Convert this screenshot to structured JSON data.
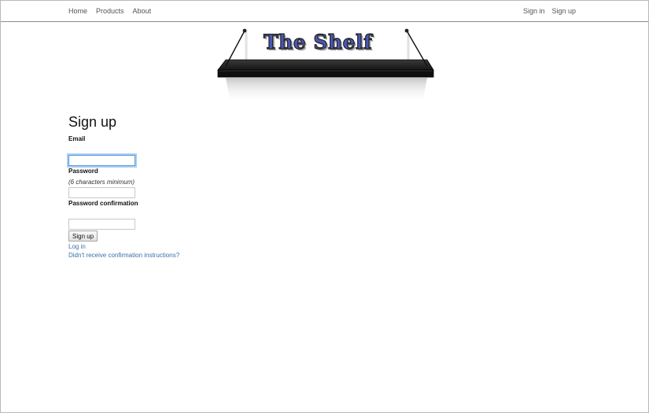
{
  "nav": {
    "left": [
      {
        "label": "Home"
      },
      {
        "label": "Products"
      },
      {
        "label": "About"
      }
    ],
    "right": [
      {
        "label": "Sign in"
      },
      {
        "label": "Sign up"
      }
    ]
  },
  "logo": {
    "text": "The Shelf"
  },
  "form": {
    "title": "Sign up",
    "email_label": "Email",
    "email_value": "",
    "password_label": "Password",
    "password_hint": "(6 characters minimum)",
    "password_value": "",
    "confirmation_label": "Password confirmation",
    "confirmation_value": "",
    "submit_label": "Sign up"
  },
  "links": {
    "login": "Log in",
    "confirmation": "Didn't receive confirmation instructions?"
  },
  "colors": {
    "link": "#3b6fa8",
    "logo_text": "#4a56b8",
    "focus": "#5b9be0"
  }
}
